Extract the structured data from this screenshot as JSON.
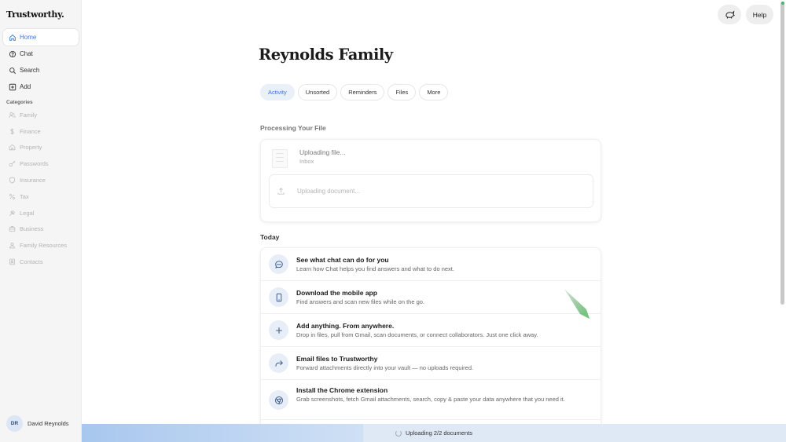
{
  "app": {
    "logo": "Trustworthy."
  },
  "sidebar": {
    "nav": [
      {
        "label": "Home",
        "icon": "home-icon",
        "active": true
      },
      {
        "label": "Chat",
        "icon": "chat-icon"
      },
      {
        "label": "Search",
        "icon": "search-icon"
      },
      {
        "label": "Add",
        "icon": "add-icon"
      }
    ],
    "categories_title": "Categories",
    "categories": [
      {
        "label": "Family",
        "icon": "family-icon"
      },
      {
        "label": "Finance",
        "icon": "dollar-icon"
      },
      {
        "label": "Property",
        "icon": "house-icon"
      },
      {
        "label": "Passwords",
        "icon": "key-icon"
      },
      {
        "label": "Insurance",
        "icon": "shield-icon"
      },
      {
        "label": "Tax",
        "icon": "percent-icon"
      },
      {
        "label": "Legal",
        "icon": "gavel-icon"
      },
      {
        "label": "Business",
        "icon": "briefcase-icon"
      },
      {
        "label": "Family Resources",
        "icon": "people-icon"
      },
      {
        "label": "Contacts",
        "icon": "contacts-icon"
      }
    ],
    "user": {
      "initials": "DR",
      "name": "David Reynolds"
    }
  },
  "header": {
    "help_label": "Help",
    "bug_icon": "bug-report-icon"
  },
  "main": {
    "title": "Reynolds Family",
    "tabs": [
      {
        "label": "Activity",
        "active": true
      },
      {
        "label": "Unsorted"
      },
      {
        "label": "Reminders"
      },
      {
        "label": "Files"
      },
      {
        "label": "More"
      }
    ],
    "processing": {
      "title": "Processing Your File",
      "file_name": "Uploading file...",
      "file_location": "Inbox",
      "upload_placeholder": "Uploading document..."
    },
    "today": {
      "title": "Today",
      "items": [
        {
          "title": "See what chat can do for you",
          "desc": "Learn how Chat helps you find answers and what to do next.",
          "icon": "chat-bubble-icon"
        },
        {
          "title": "Download the mobile app",
          "desc": "Find answers and scan new files while on the go.",
          "icon": "phone-icon"
        },
        {
          "title": "Add anything. From anywhere.",
          "desc": "Drop in files, pull from Gmail, scan documents, or connect collaborators. Just one click away.",
          "icon": "plus-icon"
        },
        {
          "title": "Email files to Trustworthy",
          "desc": "Forward attachments directly into your vault — no uploads required.",
          "icon": "forward-icon"
        },
        {
          "title": "Install the Chrome extension",
          "desc": "Grab screenshots, fetch Gmail attachments, search, copy & paste your data anywhere that you need it.",
          "icon": "chrome-icon"
        }
      ]
    }
  },
  "upload_status": {
    "text": "Uploading 2/2 documents",
    "progress_pct": 40
  },
  "colors": {
    "accent": "#3b78d8",
    "icon_bg": "#e8eef8"
  }
}
